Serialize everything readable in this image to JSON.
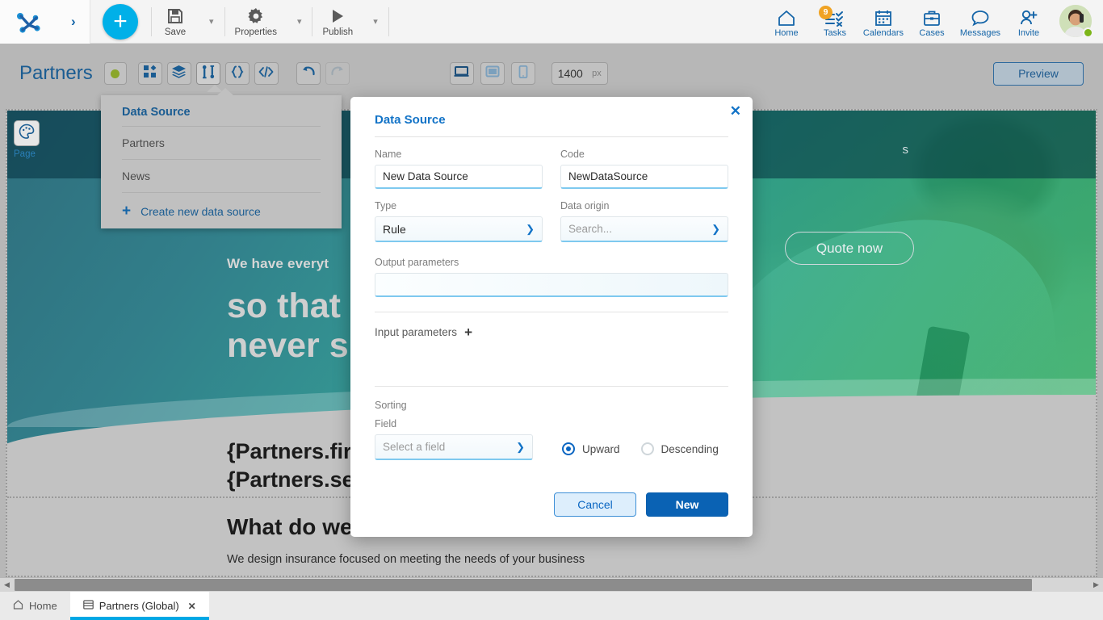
{
  "topbar": {
    "logo_name": "app-logo",
    "expand_arrow": "›",
    "add_label": "+",
    "actions": [
      {
        "label": "Save",
        "icon": "save-icon"
      },
      {
        "label": "Properties",
        "icon": "gear-icon"
      },
      {
        "label": "Publish",
        "icon": "play-icon"
      }
    ],
    "nav": [
      {
        "label": "Home",
        "icon": "home-icon",
        "badge": ""
      },
      {
        "label": "Tasks",
        "icon": "tasks-icon",
        "badge": "9"
      },
      {
        "label": "Calendars",
        "icon": "calendar-icon",
        "badge": ""
      },
      {
        "label": "Cases",
        "icon": "briefcase-icon",
        "badge": ""
      },
      {
        "label": "Messages",
        "icon": "chat-icon",
        "badge": ""
      },
      {
        "label": "Invite",
        "icon": "invite-user-icon",
        "badge": ""
      }
    ],
    "avatar_status": "online"
  },
  "subbar": {
    "page_title": "Partners",
    "status_dot_color": "#8aa62a",
    "tools": [
      {
        "name": "widgets-icon"
      },
      {
        "name": "layers-icon"
      },
      {
        "name": "data-source-icon"
      },
      {
        "name": "braces-icon"
      },
      {
        "name": "code-icon"
      },
      {
        "name": "undo-icon"
      },
      {
        "name": "redo-icon"
      }
    ],
    "devices": [
      "desktop-icon",
      "tablet-icon",
      "mobile-icon"
    ],
    "width_value": "1400",
    "width_unit": "px",
    "preview_label": "Preview"
  },
  "datasource_menu": {
    "header": "Data Source",
    "items": [
      "Partners",
      "News"
    ],
    "create_label": "Create new data source",
    "create_icon": "plus-icon"
  },
  "canvas": {
    "palette_icon": "palette-icon",
    "palette_label": "Page",
    "hero_nav_text": "s",
    "quote_button": "Quote now",
    "headline_small": "We have everyt",
    "headline_line1": "so that",
    "headline_line2": "never s",
    "bind_line1": "{Partners.firs",
    "bind_line2": "{Partners.sec",
    "section_title": "What do we",
    "section_subtitle": "We design insurance focused on meeting the needs of your business"
  },
  "modal": {
    "title": "Data Source",
    "close_icon": "close-icon",
    "name_label": "Name",
    "name_value": "New Data Source",
    "code_label": "Code",
    "code_value": "NewDataSource",
    "type_label": "Type",
    "type_value": "Rule",
    "origin_label": "Data origin",
    "origin_placeholder": "Search...",
    "output_label": "Output parameters",
    "output_value": "",
    "input_label": "Input parameters",
    "input_add_icon": "plus-icon",
    "sorting_label": "Sorting",
    "field_label": "Field",
    "field_placeholder": "Select a field",
    "radio_upward": "Upward",
    "radio_descending": "Descending",
    "selected_sort": "Upward",
    "cancel_label": "Cancel",
    "new_label": "New"
  },
  "bottom_tabs": [
    {
      "label": "Home",
      "icon": "home-icon",
      "active": false,
      "closable": false
    },
    {
      "label": "Partners (Global)",
      "icon": "page-icon",
      "active": true,
      "closable": true,
      "close_icon": "close-icon"
    }
  ]
}
